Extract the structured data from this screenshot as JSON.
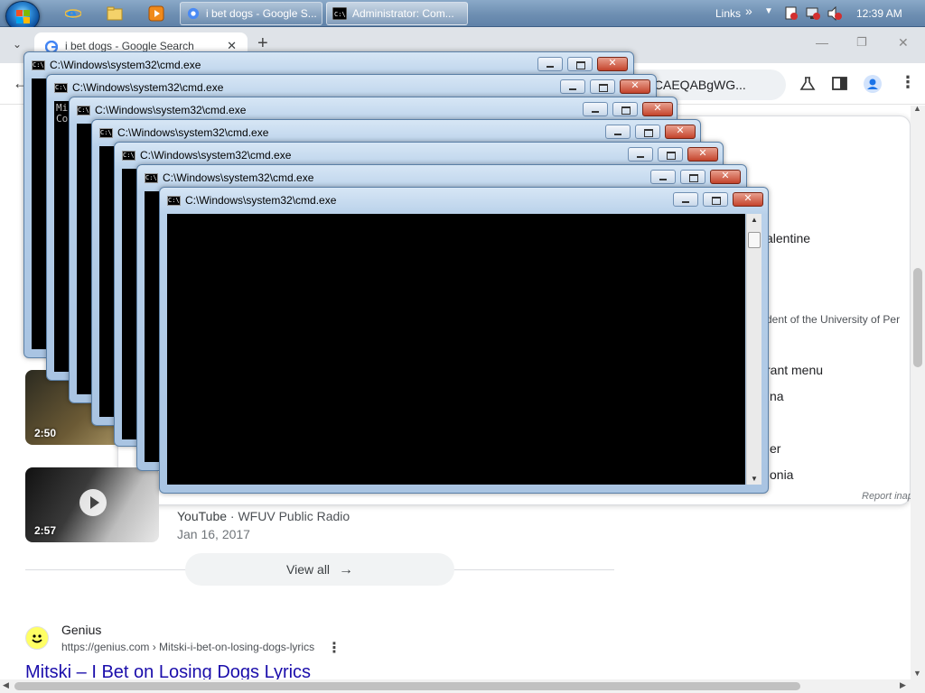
{
  "taskbar": {
    "buttons": [
      {
        "label": "i bet dogs - Google S..."
      },
      {
        "label": "Administrator: Com..."
      }
    ],
    "links_label": "Links",
    "chevron": "»",
    "clock": "12:39 AM"
  },
  "chrome": {
    "tab_title": "i bet dogs - Google Search",
    "new_tab": "+",
    "omnibox_text": "ICAEQABgWG...",
    "icons": [
      "back-icon",
      "star-icon",
      "flask-icon",
      "sidepanel-icon",
      "profile-icon",
      "menu-icon"
    ]
  },
  "cmd_windows": {
    "title": "C:\\Windows\\system32\\cmd.exe",
    "first_lines": [
      "Mi",
      "Co"
    ]
  },
  "panel": {
    "fragments": [
      "alentine",
      "dent of the University of Per",
      "rant menu",
      "na",
      "er",
      "onia"
    ],
    "report": "Report inap"
  },
  "videos": [
    {
      "duration": "2:50"
    },
    {
      "duration": "2:57"
    }
  ],
  "video_meta": {
    "source": "YouTube",
    "channel": "WFUV Public Radio",
    "separator": "·",
    "date": "Jan 16, 2017"
  },
  "view_all": "View all",
  "result": {
    "site_name": "Genius",
    "url": "https://genius.com › Mitski-i-bet-on-losing-dogs-lyrics",
    "title": "Mitski – I Bet on Losing Dogs Lyrics"
  }
}
